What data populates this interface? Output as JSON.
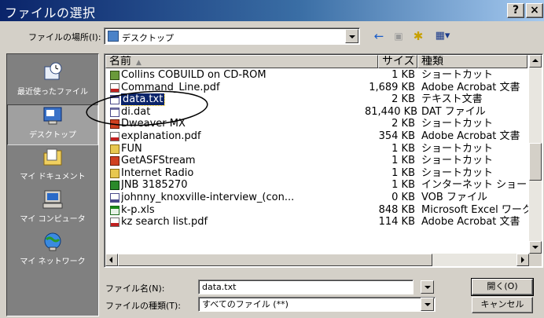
{
  "window": {
    "title": "ファイルの選択",
    "help_label": "?",
    "close_label": "×"
  },
  "lookin": {
    "label": "ファイルの場所(I):",
    "value": "デスクトップ"
  },
  "toolbar": {
    "back_icon": "←",
    "up_icon": "▣",
    "newfolder_icon": "✱",
    "view_icon": "▦▾"
  },
  "places": [
    {
      "label": "最近使ったファイル",
      "icon": "history-icon"
    },
    {
      "label": "デスクトップ",
      "icon": "desktop-icon"
    },
    {
      "label": "マイ ドキュメント",
      "icon": "my-documents-icon"
    },
    {
      "label": "マイ コンピュータ",
      "icon": "my-computer-icon"
    },
    {
      "label": "マイ ネットワーク",
      "icon": "my-network-icon"
    }
  ],
  "columns": {
    "name": "名前",
    "size": "サイズ",
    "type": "種類"
  },
  "files": [
    {
      "name": "Collins COBUILD on CD-ROM",
      "size": "1 KB",
      "type": "ショートカット",
      "icon": "shortcut"
    },
    {
      "name": "Command_Line.pdf",
      "size": "1,689 KB",
      "type": "Adobe Acrobat 文書",
      "icon": "pdf"
    },
    {
      "name": "data.txt",
      "size": "2 KB",
      "type": "テキスト文書",
      "icon": "txt"
    },
    {
      "name": "di.dat",
      "size": "81,440 KB",
      "type": "DAT ファイル",
      "icon": "dat"
    },
    {
      "name": "Dweaver MX",
      "size": "2 KB",
      "type": "ショートカット",
      "icon": "app"
    },
    {
      "name": "explanation.pdf",
      "size": "354 KB",
      "type": "Adobe Acrobat 文書",
      "icon": "pdf"
    },
    {
      "name": "FUN",
      "size": "1 KB",
      "type": "ショートカット",
      "icon": "folder"
    },
    {
      "name": "GetASFStream",
      "size": "1 KB",
      "type": "ショートカット",
      "icon": "app"
    },
    {
      "name": "Internet Radio",
      "size": "1 KB",
      "type": "ショートカット",
      "icon": "folder"
    },
    {
      "name": "JNB 3185270",
      "size": "1 KB",
      "type": "インターネット ショートカット",
      "icon": "web"
    },
    {
      "name": "johnny_knoxville-interview_(con...",
      "size": "0 KB",
      "type": "VOB ファイル",
      "icon": "vob"
    },
    {
      "name": "k-p.xls",
      "size": "848 KB",
      "type": "Microsoft Excel ワークシート",
      "icon": "xls"
    },
    {
      "name": "kz search list.pdf",
      "size": "114 KB",
      "type": "Adobe Acrobat 文書",
      "icon": "pdf"
    }
  ],
  "selected_index": 2,
  "filename": {
    "label": "ファイル名(N):",
    "value": "data.txt"
  },
  "filetype": {
    "label": "ファイルの種類(T):",
    "value": "すべてのファイル (**)"
  },
  "buttons": {
    "open": "開く(O)",
    "cancel": "キャンセル"
  }
}
